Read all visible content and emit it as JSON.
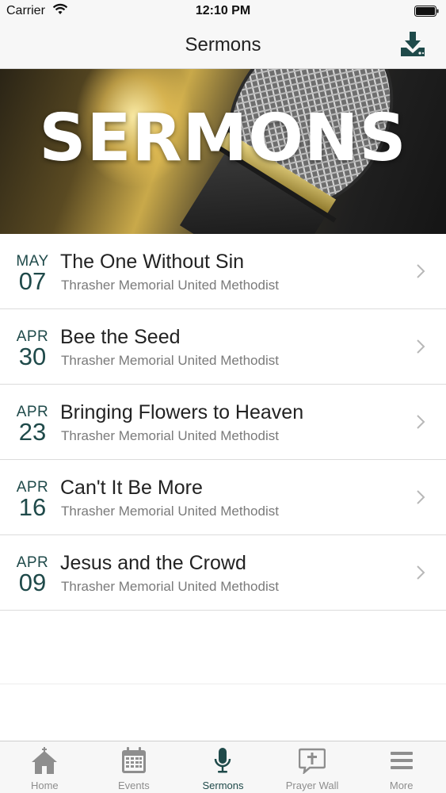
{
  "status_bar": {
    "carrier": "Carrier",
    "time": "12:10 PM"
  },
  "nav": {
    "title": "Sermons"
  },
  "hero": {
    "text": "SERMONS"
  },
  "sermons": [
    {
      "month": "MAY",
      "day": "07",
      "title": "The One Without Sin",
      "subtitle": "Thrasher Memorial United Methodist"
    },
    {
      "month": "APR",
      "day": "30",
      "title": "Bee the Seed",
      "subtitle": "Thrasher Memorial United Methodist"
    },
    {
      "month": "APR",
      "day": "23",
      "title": "Bringing Flowers to Heaven",
      "subtitle": "Thrasher Memorial United Methodist"
    },
    {
      "month": "APR",
      "day": "16",
      "title": "Can't It Be More",
      "subtitle": "Thrasher Memorial United Methodist"
    },
    {
      "month": "APR",
      "day": "09",
      "title": "Jesus and the Crowd",
      "subtitle": "Thrasher Memorial United Methodist"
    }
  ],
  "tabs": [
    {
      "label": "Home",
      "icon": "church-icon"
    },
    {
      "label": "Events",
      "icon": "calendar-icon"
    },
    {
      "label": "Sermons",
      "icon": "microphone-icon"
    },
    {
      "label": "Prayer Wall",
      "icon": "cross-bubble-icon"
    },
    {
      "label": "More",
      "icon": "menu-icon"
    }
  ],
  "colors": {
    "accent": "#1f4a4a",
    "inactive": "#8e8e8e",
    "bar_background": "#f7f7f7"
  }
}
